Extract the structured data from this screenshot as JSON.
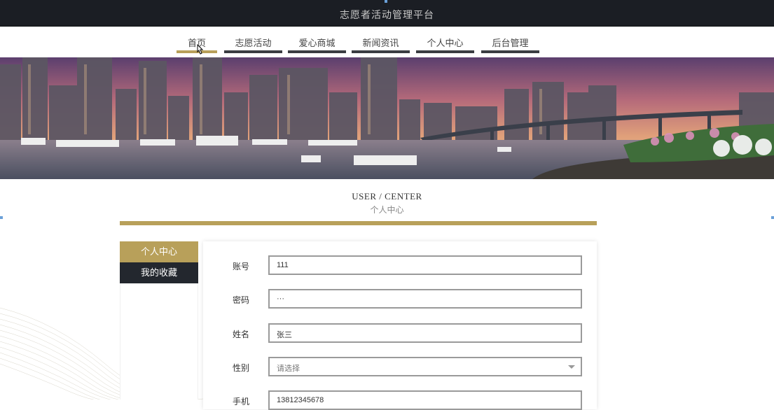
{
  "app": {
    "title": "志愿者活动管理平台"
  },
  "nav": {
    "items": [
      {
        "label": "首页",
        "active": true
      },
      {
        "label": "志愿活动",
        "active": false
      },
      {
        "label": "爱心商城",
        "active": false
      },
      {
        "label": "新闻资讯",
        "active": false
      },
      {
        "label": "个人中心",
        "active": false
      },
      {
        "label": "后台管理",
        "active": false
      }
    ]
  },
  "section": {
    "title_en": "USER / CENTER",
    "title_cn": "个人中心"
  },
  "sidebar": {
    "items": [
      {
        "label": "个人中心",
        "active": true
      },
      {
        "label": "我的收藏",
        "active": false
      }
    ]
  },
  "form": {
    "fields": [
      {
        "label": "账号",
        "value": "111",
        "type": "text"
      },
      {
        "label": "密码",
        "value": "···",
        "type": "password"
      },
      {
        "label": "姓名",
        "value": "张三",
        "type": "text"
      },
      {
        "label": "性别",
        "value": "请选择",
        "type": "select"
      },
      {
        "label": "手机",
        "value": "13812345678",
        "type": "text"
      }
    ]
  },
  "colors": {
    "accent": "#b8a05a",
    "dark": "#23272e",
    "topbar": "#1b1e24"
  }
}
